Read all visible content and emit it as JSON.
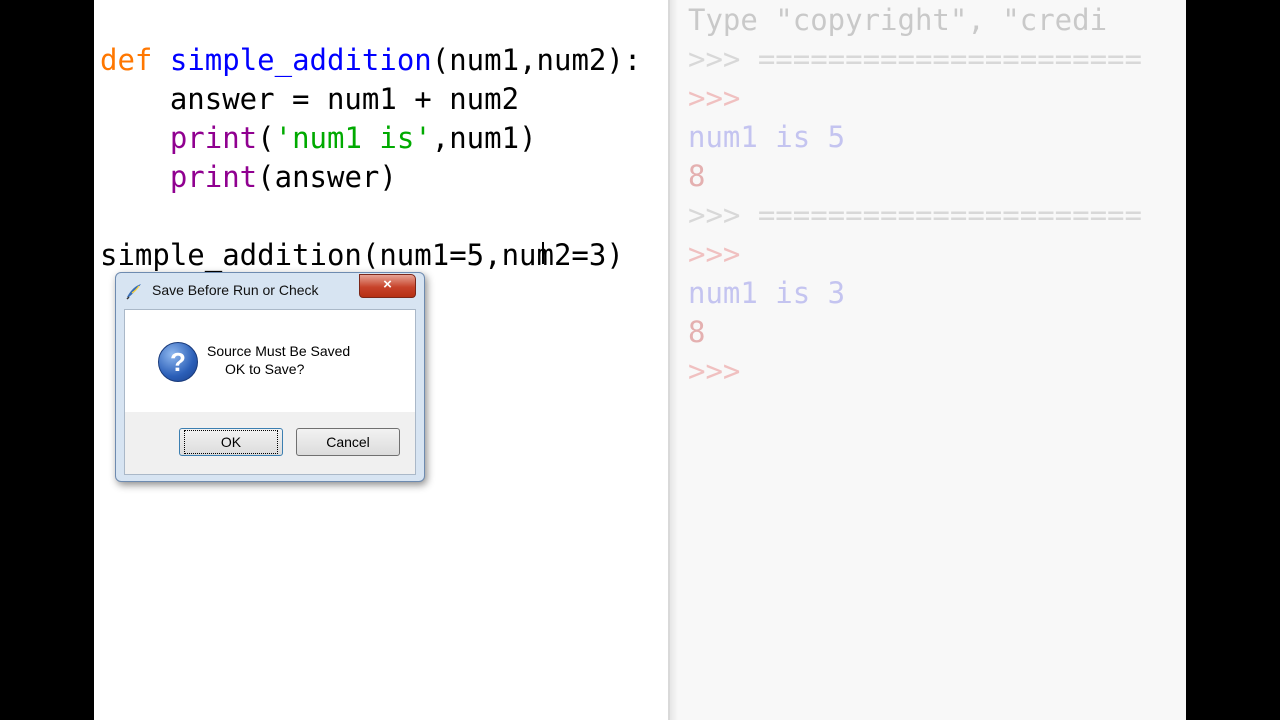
{
  "editor": {
    "line1": {
      "kw": "def",
      "fn": "simple_addition",
      "rest": "(num1,num2):"
    },
    "line2": {
      "text": "    answer = num1 + num2"
    },
    "line3": {
      "indent": "    ",
      "bi": "print",
      "open": "(",
      "str": "'num1 is'",
      "rest": ",num1)"
    },
    "line4": {
      "indent": "    ",
      "bi": "print",
      "rest": "(answer)"
    },
    "line5": {
      "text": "simple_addition(num1=5,num2=3)"
    }
  },
  "shell": {
    "line0": "Type \"copyright\", \"credi",
    "line1": ">>> ======================",
    "line2": ">>>",
    "line3": "num1 is 5",
    "line4": "8",
    "line5": ">>> ======================",
    "line6": ">>>",
    "line7": "num1 is 3",
    "line8": "8",
    "line9": ">>>"
  },
  "dialog": {
    "title": "Save Before Run or Check",
    "close": "×",
    "message_line1": "Source Must Be Saved",
    "message_line2": "OK to Save?",
    "icon_glyph": "?",
    "ok_label": "OK",
    "cancel_label": "Cancel"
  }
}
